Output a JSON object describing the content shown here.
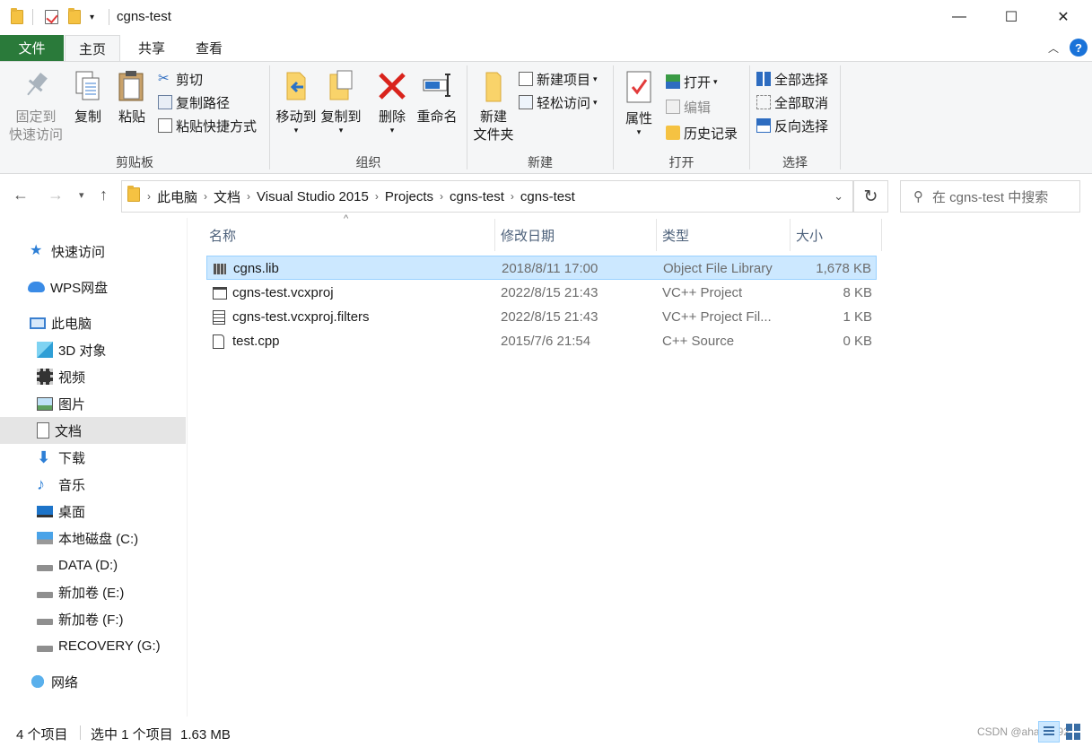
{
  "window": {
    "title": "cgns-test",
    "controls": {
      "minimize": "—",
      "maximize": "☐",
      "close": "✕"
    }
  },
  "ribbon_tabs": [
    "文件",
    "主页",
    "共享",
    "查看"
  ],
  "ribbon": {
    "clipboard": {
      "label": "剪贴板",
      "pin": "固定到\n快速访问",
      "pin_line1": "固定到",
      "pin_line2": "快速访问",
      "copy": "复制",
      "paste": "粘贴",
      "cut": "剪切",
      "copy_path": "复制路径",
      "paste_shortcut": "粘贴快捷方式"
    },
    "organize": {
      "label": "组织",
      "move_to": "移动到",
      "copy_to": "复制到",
      "delete": "删除",
      "rename": "重命名"
    },
    "new": {
      "label": "新建",
      "new_folder_line1": "新建",
      "new_folder_line2": "文件夹",
      "new_item": "新建项目",
      "easy_access": "轻松访问"
    },
    "open": {
      "label": "打开",
      "properties": "属性",
      "open": "打开",
      "edit": "编辑",
      "history": "历史记录"
    },
    "select": {
      "label": "选择",
      "select_all": "全部选择",
      "select_none": "全部取消",
      "invert": "反向选择"
    }
  },
  "address": {
    "crumbs": [
      "此电脑",
      "文档",
      "Visual Studio 2015",
      "Projects",
      "cgns-test",
      "cgns-test"
    ],
    "search_placeholder": "在 cgns-test 中搜索"
  },
  "sidebar": {
    "items": [
      {
        "label": "快速访问",
        "icon": "star-icon"
      },
      {
        "label": "WPS网盘",
        "icon": "cloud-icon"
      },
      {
        "label": "此电脑",
        "icon": "computer-icon"
      },
      {
        "label": "3D 对象",
        "icon": "cube-icon"
      },
      {
        "label": "视频",
        "icon": "video-icon"
      },
      {
        "label": "图片",
        "icon": "picture-icon"
      },
      {
        "label": "文档",
        "icon": "document-icon"
      },
      {
        "label": "下载",
        "icon": "download-icon"
      },
      {
        "label": "音乐",
        "icon": "music-icon"
      },
      {
        "label": "桌面",
        "icon": "desktop-icon"
      },
      {
        "label": "本地磁盘 (C:)",
        "icon": "windows-drive-icon"
      },
      {
        "label": "DATA (D:)",
        "icon": "drive-icon"
      },
      {
        "label": "新加卷 (E:)",
        "icon": "drive-icon"
      },
      {
        "label": "新加卷 (F:)",
        "icon": "drive-icon"
      },
      {
        "label": "RECOVERY (G:)",
        "icon": "drive-icon"
      },
      {
        "label": "网络",
        "icon": "network-icon"
      }
    ],
    "selected": "文档"
  },
  "columns": {
    "name": "名称",
    "modified": "修改日期",
    "type": "类型",
    "size": "大小"
  },
  "files": [
    {
      "name": "cgns.lib",
      "modified": "2018/8/11 17:00",
      "type": "Object File Library",
      "size": "1,678 KB",
      "selected": true
    },
    {
      "name": "cgns-test.vcxproj",
      "modified": "2022/8/15 21:43",
      "type": "VC++ Project",
      "size": "8 KB",
      "selected": false
    },
    {
      "name": "cgns-test.vcxproj.filters",
      "modified": "2022/8/15 21:43",
      "type": "VC++ Project Fil...",
      "size": "1 KB",
      "selected": false
    },
    {
      "name": "test.cpp",
      "modified": "2015/7/6 21:54",
      "type": "C++ Source",
      "size": "0 KB",
      "selected": false
    }
  ],
  "status": {
    "count": "4 个项目",
    "selection": "选中 1 个项目  1.63 MB",
    "watermark": "CSDN @ahang_92"
  },
  "colors": {
    "file_tab": "#2a7a3a",
    "selection": "#cce8ff",
    "selection_border": "#99d1ff",
    "sidebar_selected": "#e5e5e5",
    "help": "#1a73d9"
  }
}
